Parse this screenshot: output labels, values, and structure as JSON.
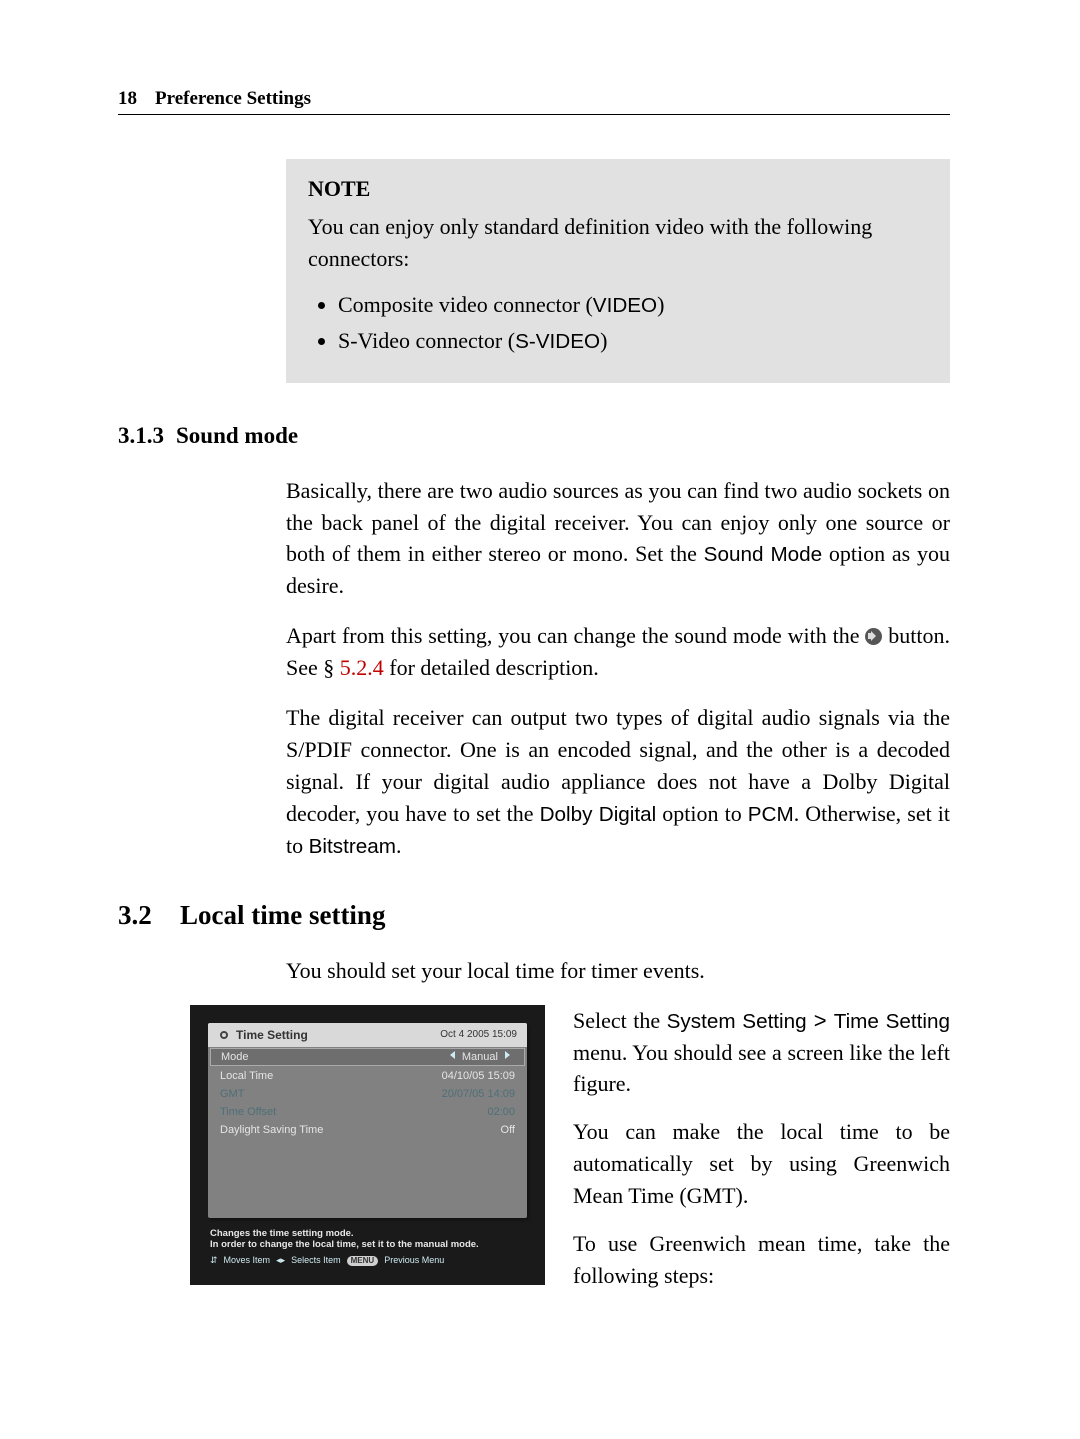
{
  "header": {
    "page_num": "18",
    "title": "Preference Settings"
  },
  "note": {
    "label": "NOTE",
    "text": "You can enjoy only standard definition video with the following connectors:",
    "items": {
      "0": {
        "pretext": "Composite video connector (",
        "code": "VIDEO",
        "post": ")"
      },
      "1": {
        "pretext": "S-Video connector (",
        "code": "S-VIDEO",
        "post": ")"
      }
    }
  },
  "sub313": {
    "num": "3.1.3",
    "title": "Sound mode"
  },
  "p1a": "Basically, there are two audio sources as you can find two audio sockets on the back panel of the digital receiver. You can enjoy only one source or both of them in either stereo or mono. Set the ",
  "p1_code": "Sound Mode",
  "p1b": " option as you desire.",
  "p2a": "Apart from this setting, you can change the sound mode with the ",
  "p2b": " button. See § ",
  "p2_ref": "5.2.4",
  "p2c": " for detailed description.",
  "p3a": "The digital receiver can output two types of digital audio signals via the S/PDIF connector. One is an encoded signal, and the other is a decoded signal. If your digital audio appliance does not have a Dolby Digital decoder, you have to set the ",
  "p3_code1": "Dolby Digital",
  "p3b": " option to ",
  "p3_code2": "PCM",
  "p3c": ". Otherwise, set it to ",
  "p3_code3": "Bitstream",
  "p3d": ".",
  "sec32": {
    "num": "3.2",
    "title": "Local time setting"
  },
  "p4": "You should set your local time for timer events.",
  "figure": {
    "title": "Time Setting",
    "timestamp": "Oct 4 2005 15:09",
    "rows": {
      "0": {
        "label": "Mode",
        "value": "Manual",
        "selected": true
      },
      "1": {
        "label": "Local Time",
        "value": "04/10/05 15:09"
      },
      "2": {
        "label": "GMT",
        "value": "20/07/05 14:09",
        "disabled": true
      },
      "3": {
        "label": "Time Offset",
        "value": "02:00",
        "disabled": true
      },
      "4": {
        "label": "Daylight Saving Time",
        "value": "Off"
      }
    },
    "hint1": "Changes the time setting mode.",
    "hint2": "In order to change the local time, set it to the manual mode.",
    "nav1": "Moves Item",
    "nav2": "Selects Item",
    "nav3_pill": "MENU",
    "nav3": "Previous Menu"
  },
  "r1a": "Select the ",
  "r1_code1": "System Setting",
  "r1_gt": " > ",
  "r1_code2": "Time Setting",
  "r1b": " menu. You should see a screen like the left figure.",
  "r2": "You can make the local time to be automatically set by using Greenwich Mean Time (GMT).",
  "r3": "To use Greenwich mean time, take the following steps:"
}
